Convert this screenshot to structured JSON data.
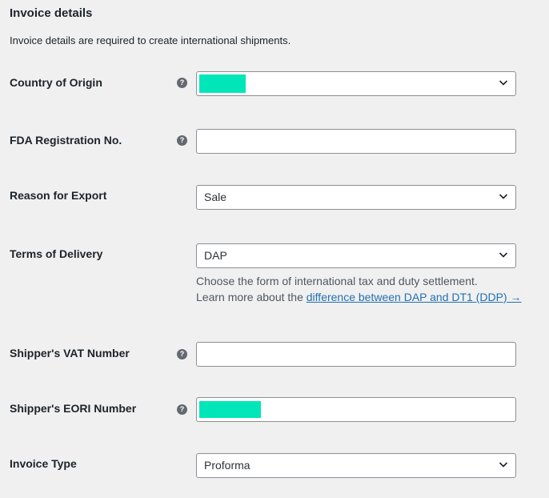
{
  "section": {
    "title": "Invoice details",
    "description": "Invoice details are required to create international shipments."
  },
  "fields": {
    "country_of_origin": {
      "label": "Country of Origin",
      "value": ""
    },
    "fda_registration": {
      "label": "FDA Registration No.",
      "value": ""
    },
    "reason_for_export": {
      "label": "Reason for Export",
      "value": "Sale"
    },
    "terms_of_delivery": {
      "label": "Terms of Delivery",
      "value": "DAP",
      "hint_line1": "Choose the form of international tax and duty settlement.",
      "hint_line2_prefix": "Learn more about the ",
      "hint_link": "difference between DAP and DT1 (DDP) →"
    },
    "shipper_vat": {
      "label": "Shipper's VAT Number",
      "value": ""
    },
    "shipper_eori": {
      "label": "Shipper's EORI Number",
      "value": ""
    },
    "invoice_type": {
      "label": "Invoice Type",
      "value": "Proforma"
    }
  },
  "icons": {
    "help": "question-circle-icon",
    "dropdown": "chevron-down-icon"
  },
  "colors": {
    "background": "#f0f0f1",
    "link": "#2271b1",
    "redaction": "#00e6b8"
  }
}
